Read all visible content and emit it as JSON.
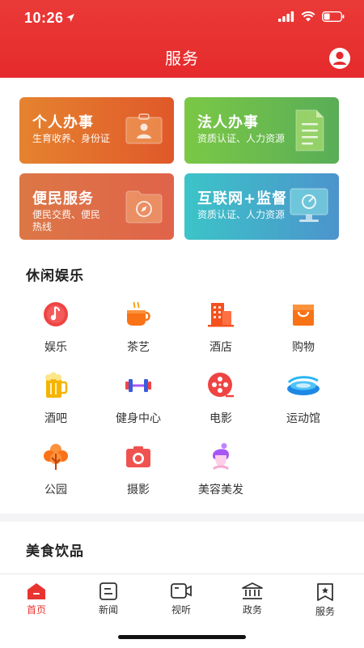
{
  "status_bar": {
    "time": "10:26"
  },
  "header": {
    "title": "服务"
  },
  "service_cards": [
    {
      "title": "个人办事",
      "subtitle": "生育收养、身份证",
      "icon": "id-card-icon",
      "colors": [
        "#e5832f",
        "#e0582a"
      ]
    },
    {
      "title": "法人办事",
      "subtitle": "资质认证、人力资源",
      "icon": "document-icon",
      "colors": [
        "#7bc846",
        "#59ad57"
      ]
    },
    {
      "title": "便民服务",
      "subtitle": "便民交费、便民热线",
      "icon": "folder-compass-icon",
      "colors": [
        "#dc7746",
        "#e0634a"
      ]
    },
    {
      "title": "互联网+监督",
      "subtitle": "资质认证、人力资源",
      "icon": "monitor-icon",
      "colors": [
        "#3cc4c8",
        "#4c94cc"
      ]
    }
  ],
  "leisure": {
    "title": "休闲娱乐",
    "items": [
      {
        "label": "娱乐",
        "icon": "music-icon"
      },
      {
        "label": "茶艺",
        "icon": "tea-cup-icon"
      },
      {
        "label": "酒店",
        "icon": "hotel-icon"
      },
      {
        "label": "购物",
        "icon": "shopping-bag-icon"
      },
      {
        "label": "酒吧",
        "icon": "beer-icon"
      },
      {
        "label": "健身中心",
        "icon": "dumbbell-icon"
      },
      {
        "label": "电影",
        "icon": "film-reel-icon"
      },
      {
        "label": "运动馆",
        "icon": "stadium-icon"
      },
      {
        "label": "公园",
        "icon": "tree-icon"
      },
      {
        "label": "摄影",
        "icon": "camera-icon"
      },
      {
        "label": "美容美发",
        "icon": "beauty-icon"
      }
    ]
  },
  "food": {
    "title": "美食饮品"
  },
  "tabbar": {
    "items": [
      {
        "label": "首页",
        "icon": "home-icon",
        "active": true
      },
      {
        "label": "新闻",
        "icon": "news-icon",
        "active": false
      },
      {
        "label": "视听",
        "icon": "video-icon",
        "active": false
      },
      {
        "label": "政务",
        "icon": "government-icon",
        "active": false
      },
      {
        "label": "服务",
        "icon": "service-icon",
        "active": false
      }
    ]
  },
  "colors": {
    "brand": "#e83431",
    "header_bg": "#e52a2c"
  }
}
